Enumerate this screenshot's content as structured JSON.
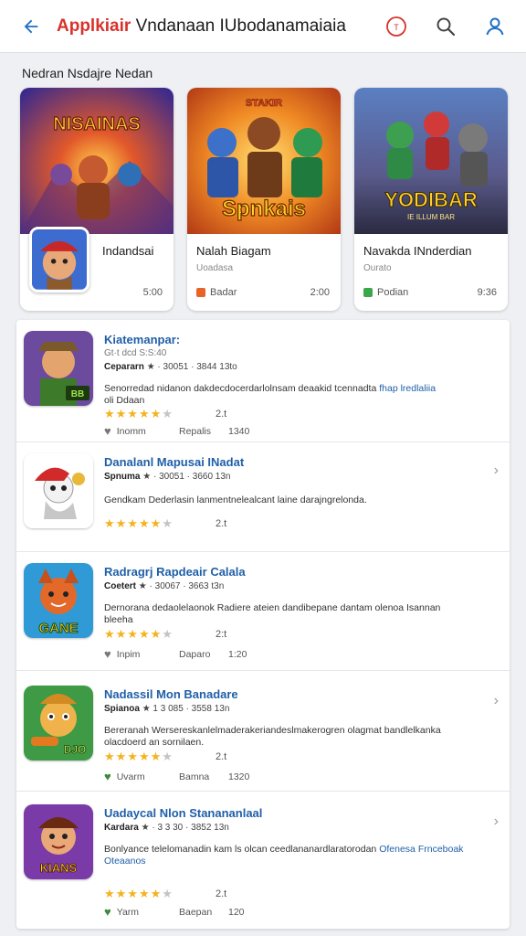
{
  "appbar": {
    "title_accent": "Applkiair",
    "title_rest": " Vndanaan IUbodanamaiaia",
    "icons": [
      "back-arrow-icon",
      "badge-icon",
      "search-icon",
      "profile-icon"
    ]
  },
  "section": {
    "title": "Nedran Nsdajre Nedan"
  },
  "featured": [
    {
      "banner_text": "NISAINAS",
      "name": "Indandsai",
      "sub": "",
      "price": "5:00",
      "tag": ""
    },
    {
      "banner_text": "Spnkais",
      "banner_top": "STAKIR",
      "name": "Nalah Biagam",
      "sub": "Uoadasa",
      "tag": "Badar",
      "price": "2:00"
    },
    {
      "banner_text": "YODIBAR",
      "banner_sub": "IE ILLUM BAR",
      "name": "Navakda INnderdian",
      "sub": "Ourato",
      "tag": "Podian",
      "price": "9:36"
    }
  ],
  "colors": {
    "accent": "#d9312b",
    "link": "#1f5fa8",
    "star": "#f3b320"
  },
  "list": [
    {
      "title": "Kiatemanpar:",
      "meta_line1": "Gt·t dcd  S:S:40",
      "publisher": "Cepararn",
      "meta": "★ · 30051 · 3844 13to",
      "desc": "Senorredad nidanon dakdecdocerdarlolnsam deaakid tcennadta",
      "desc_link": "fhap lredlaliia",
      "desc2": "oli Ddaan",
      "stars": 5,
      "rating_num": "2.t",
      "foot1": "Inomm",
      "foot2": "Repalis",
      "foot3": "1340",
      "icon_text": "BB"
    },
    {
      "title": "Danalanl Mapusai INadat",
      "publisher": "Spnuma",
      "meta": "★ · 30051 · 3660 13n",
      "desc": "Gendkam Dederlasin lanmentnelealcant laine darajngrelonda.",
      "stars": 5,
      "rating_num": "2.t",
      "icon_text": ""
    },
    {
      "title": "Radragrj Rapdeair Calala",
      "publisher": "Coetert",
      "meta": "★ · 30067 · 3663 t3n",
      "desc": "Dernorana dedaolelaonok Radiere ateien dandibepane dantam olenoa Isannan",
      "desc2": "bleeha",
      "stars": 5,
      "rating_num": "2:t",
      "foot1": "Inpim",
      "foot2": "Daparo",
      "foot3": "1:20",
      "icon_text": "GANE"
    },
    {
      "title": "Nadassil Mon Banadare",
      "publisher": "Spianoa",
      "meta": "★ 1 3 085 · 3558 13n",
      "desc": "Bereranah Wersereskanlelmaderakeriandeslmakerogren olagmat bandlelkanka",
      "desc2": "olacdoerd an sornilaen.",
      "stars": 5,
      "rating_num": "2.t",
      "foot1": "Uvarm",
      "foot2": "Bamna",
      "foot3": "1320",
      "icon_text": "DJO"
    },
    {
      "title": "Uadaycal Nlon Stanananlaal",
      "publisher": "Kardara",
      "meta": "★ · 3 3 30 · 3852 13n",
      "desc": "Bonlyance telelomanadin kam ls olcan ceedlananardlaratorodan",
      "desc_link": "Ofenesa Frnceboak",
      "desc2": "Oteaanos",
      "stars": 5,
      "rating_num": "2.t",
      "foot1": "Yarm",
      "foot2": "Baepan",
      "foot3": "120",
      "icon_text": "KIANS"
    }
  ]
}
